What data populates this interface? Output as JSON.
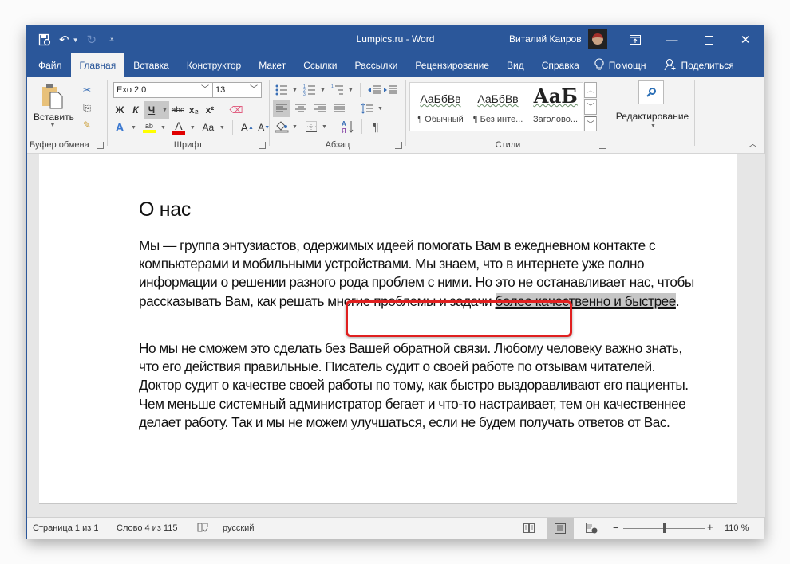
{
  "titlebar": {
    "doc_title": "Lumpics.ru  -  Word",
    "user_name": "Виталий Каиров",
    "qat": {
      "save_icon": "save-autosave-icon",
      "undo_icon": "undo-icon",
      "redo_icon": "redo-icon",
      "customize_icon": "customize-qat-icon"
    },
    "window_buttons": [
      "ribbon-display-options",
      "minimize",
      "maximize",
      "close"
    ]
  },
  "tabs": [
    {
      "label": "Файл",
      "active": false
    },
    {
      "label": "Главная",
      "active": true
    },
    {
      "label": "Вставка",
      "active": false
    },
    {
      "label": "Конструктор",
      "active": false
    },
    {
      "label": "Макет",
      "active": false
    },
    {
      "label": "Ссылки",
      "active": false
    },
    {
      "label": "Рассылки",
      "active": false
    },
    {
      "label": "Рецензирование",
      "active": false
    },
    {
      "label": "Вид",
      "active": false
    },
    {
      "label": "Справка",
      "active": false
    },
    {
      "label": "Помощн",
      "active": false,
      "icon": "lightbulb-icon"
    },
    {
      "label": "Поделиться",
      "active": false,
      "icon": "share-person-icon"
    }
  ],
  "ribbon": {
    "clipboard": {
      "label": "Буфер обмена",
      "paste_label": "Вставить",
      "cut_glyph": "✂",
      "copy_glyph": "⎘",
      "format_painter_glyph": "🖌"
    },
    "font": {
      "label": "Шрифт",
      "font_name": "Exo 2.0",
      "font_size": "13",
      "bold": "Ж",
      "italic": "К",
      "underline": "Ч",
      "underline_active": true,
      "strikethrough": "abc",
      "subscript": "x₂",
      "superscript": "x²",
      "text_effects": "A",
      "highlight": "ab",
      "highlight_color": "#ffff00",
      "font_color": "A",
      "font_color_value": "#e00000",
      "change_case": "Aa",
      "grow": "A",
      "shrink": "A"
    },
    "paragraph": {
      "label": "Абзац",
      "align_left_active": true,
      "pilcrow": "¶"
    },
    "styles": {
      "label": "Стили",
      "items": [
        {
          "preview": "АаБбВв",
          "name": "¶ Обычный"
        },
        {
          "preview": "АаБбВв",
          "name": "¶ Без инте..."
        },
        {
          "preview": "АаБ",
          "name": "Заголово..."
        }
      ]
    },
    "editing": {
      "label": "Редактирование"
    }
  },
  "document": {
    "heading": "О нас",
    "para1_before": "Мы — группа энтузиастов, одержимых идеей помогать Вам в ежедневном контакте с компьютерами и мобильными устройствами. Мы знаем, что в интернете уже полно информации о решении разного рода проблем с ними. Но это не останавливает нас, чтобы рассказывать Вам, как решать многие проблемы и задачи ",
    "para1_selected": "более качественно и быстрее",
    "para1_after": ".",
    "para2": "Но мы не сможем это сделать без Вашей обратной связи. Любому человеку важно знать, что его действия правильные. Писатель судит о своей работе по отзывам читателей. Доктор судит о качестве своей работы по тому, как быстро выздоравливают его пациенты. Чем меньше системный администратор бегает и что-то настраивает, тем он качественнее делает работу. Так и мы не можем улучшаться, если не будем получать ответов от Вас."
  },
  "statusbar": {
    "page": "Страница 1 из 1",
    "words": "Слово 4 из 115",
    "language": "русский",
    "zoom_minus": "−",
    "zoom_plus": "+",
    "zoom_level": "110 %",
    "zoom_percent": 110,
    "active_view": "print-layout"
  },
  "colors": {
    "accent": "#2b579a",
    "selection": "#c6c6c6",
    "callout": "#e02020"
  }
}
